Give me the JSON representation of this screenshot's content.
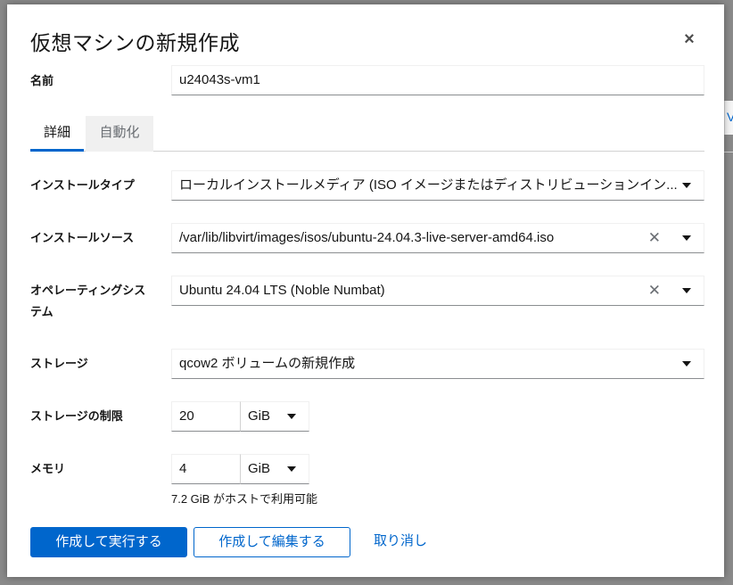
{
  "dialog": {
    "title": "仮想マシンの新規作成",
    "close_icon": "×"
  },
  "name": {
    "label": "名前",
    "value": "u24043s-vm1"
  },
  "tabs": [
    {
      "label": "詳細",
      "active": true
    },
    {
      "label": "自動化",
      "active": false
    }
  ],
  "install_type": {
    "label": "インストールタイプ",
    "value": "ローカルインストールメディア (ISO イメージまたはディストリビューションイン..."
  },
  "install_source": {
    "label": "インストールソース",
    "value": "/var/lib/libvirt/images/isos/ubuntu-24.04.3-live-server-amd64.iso"
  },
  "os": {
    "label_line1": "オペレーティングシス",
    "label_line2": "テム",
    "value": "Ubuntu 24.04 LTS (Noble Numbat)"
  },
  "storage": {
    "label": "ストレージ",
    "value": "qcow2 ボリュームの新規作成"
  },
  "storage_limit": {
    "label": "ストレージの制限",
    "value": "20",
    "unit": "GiB"
  },
  "memory": {
    "label": "メモリ",
    "value": "4",
    "unit": "GiB",
    "helper": "7.2 GiB がホストで利用可能"
  },
  "buttons": {
    "create_run": "作成して実行する",
    "create_edit": "作成して編集する",
    "cancel": "取り消し"
  },
  "colors": {
    "accent": "#0066cc",
    "overlay": "#8a8a8a"
  }
}
